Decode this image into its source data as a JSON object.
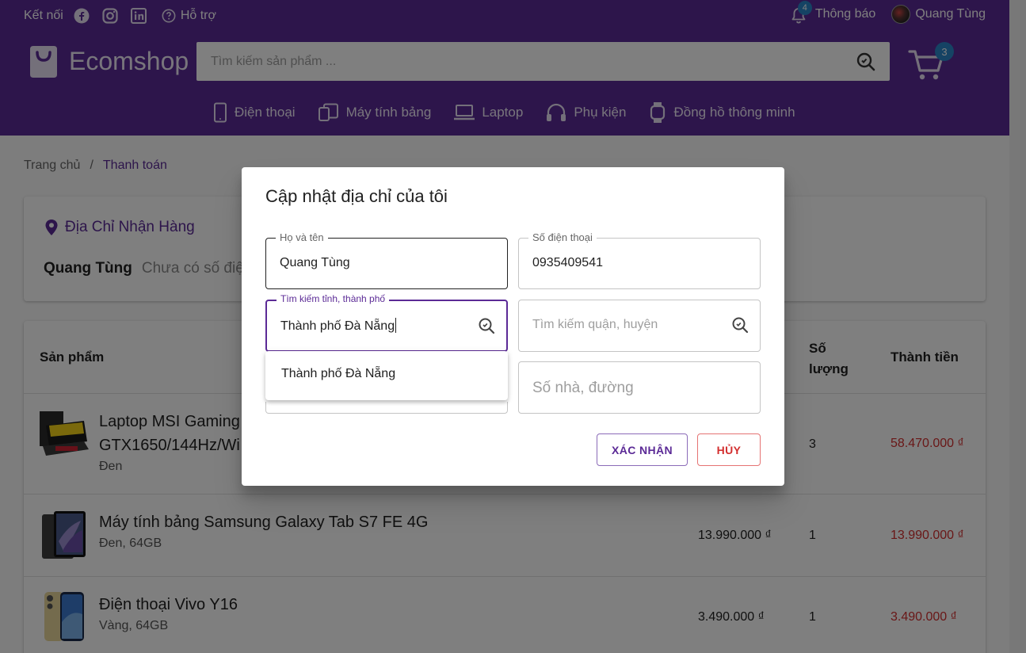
{
  "topbar": {
    "connect_label": "Kết nối",
    "support_label": "Hỗ trợ",
    "notifications_label": "Thông báo",
    "notifications_count": "4",
    "user_name": "Quang Tùng"
  },
  "header": {
    "brand": "Ecomshop",
    "search_placeholder": "Tìm kiếm sản phẩm ...",
    "cart_count": "3"
  },
  "categories": [
    {
      "label": "Điện thoại",
      "icon": "phone-icon"
    },
    {
      "label": "Máy tính bảng",
      "icon": "tablet-icon"
    },
    {
      "label": "Laptop",
      "icon": "laptop-icon"
    },
    {
      "label": "Phụ kiện",
      "icon": "headphones-icon"
    },
    {
      "label": "Đồng hồ thông minh",
      "icon": "watch-icon"
    }
  ],
  "breadcrumb": {
    "home": "Trang chủ",
    "separator": "/",
    "current": "Thanh toán"
  },
  "address": {
    "title": "Địa Chỉ Nhận Hàng",
    "name": "Quang Tùng",
    "phone_text": "Chưa có số điệ"
  },
  "table": {
    "headers": {
      "product": "Sản phẩm",
      "qty": "Số lượng",
      "total": "Thành tiền"
    },
    "rows": [
      {
        "name_line1": "Laptop MSI Gaming",
        "name_line2": "GTX1650/144Hz/Wi",
        "variant": "Đen",
        "price": "",
        "qty": "3",
        "total": "58.470.000 ₫"
      },
      {
        "name_line1": "Máy tính bảng Samsung Galaxy Tab S7 FE 4G",
        "name_line2": "",
        "variant": "Đen, 64GB",
        "price": "13.990.000 ₫",
        "qty": "1",
        "total": "13.990.000 ₫"
      },
      {
        "name_line1": "Điện thoại Vivo Y16",
        "name_line2": "",
        "variant": "Vàng, 64GB",
        "price": "3.490.000 ₫",
        "qty": "1",
        "total": "3.490.000 ₫"
      }
    ]
  },
  "dialog": {
    "title": "Cập nhật địa chỉ của tôi",
    "fullname": {
      "label": "Họ và tên",
      "value": "Quang Tùng"
    },
    "phone": {
      "label": "Số điện thoại",
      "value": "0935409541"
    },
    "province": {
      "label": "Tìm kiếm tỉnh, thành phố",
      "value": "Thành phố Đà Nẵng"
    },
    "district": {
      "placeholder": "Tìm kiếm quận, huyện"
    },
    "street": {
      "placeholder": "Số nhà, đường"
    },
    "suggestion": "Thành phố Đà Nẵng",
    "confirm_label": "XÁC NHẬN",
    "cancel_label": "HỦY"
  },
  "colors": {
    "primary": "#5b2a96",
    "badge": "#2a86c8",
    "danger": "#d32f2f"
  }
}
